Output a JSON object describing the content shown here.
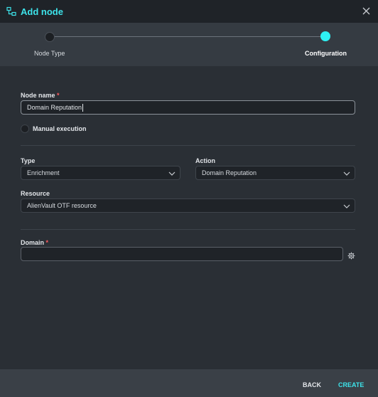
{
  "header": {
    "title": "Add node",
    "icon": "node-graph-icon",
    "close_icon": "close-icon"
  },
  "stepper": {
    "steps": [
      {
        "label": "Node Type",
        "state": "done"
      },
      {
        "label": "Configuration",
        "state": "active"
      }
    ],
    "active_color": "#2ef1f3"
  },
  "form": {
    "node_name": {
      "label": "Node name",
      "required_mark": "*",
      "value": "Domain Reputation"
    },
    "manual_execution": {
      "label": "Manual execution",
      "checked": false
    },
    "type": {
      "label": "Type",
      "value": "Enrichment"
    },
    "action": {
      "label": "Action",
      "value": "Domain Reputation"
    },
    "resource": {
      "label": "Resource",
      "value": "AlienVault OTF resource"
    },
    "domain": {
      "label": "Domain",
      "required_mark": "*",
      "value": ""
    }
  },
  "footer": {
    "back_label": "BACK",
    "create_label": "CREATE"
  },
  "colors": {
    "accent": "#3de3ea",
    "required": "#ff5a5f",
    "background": "#2a2f35"
  }
}
